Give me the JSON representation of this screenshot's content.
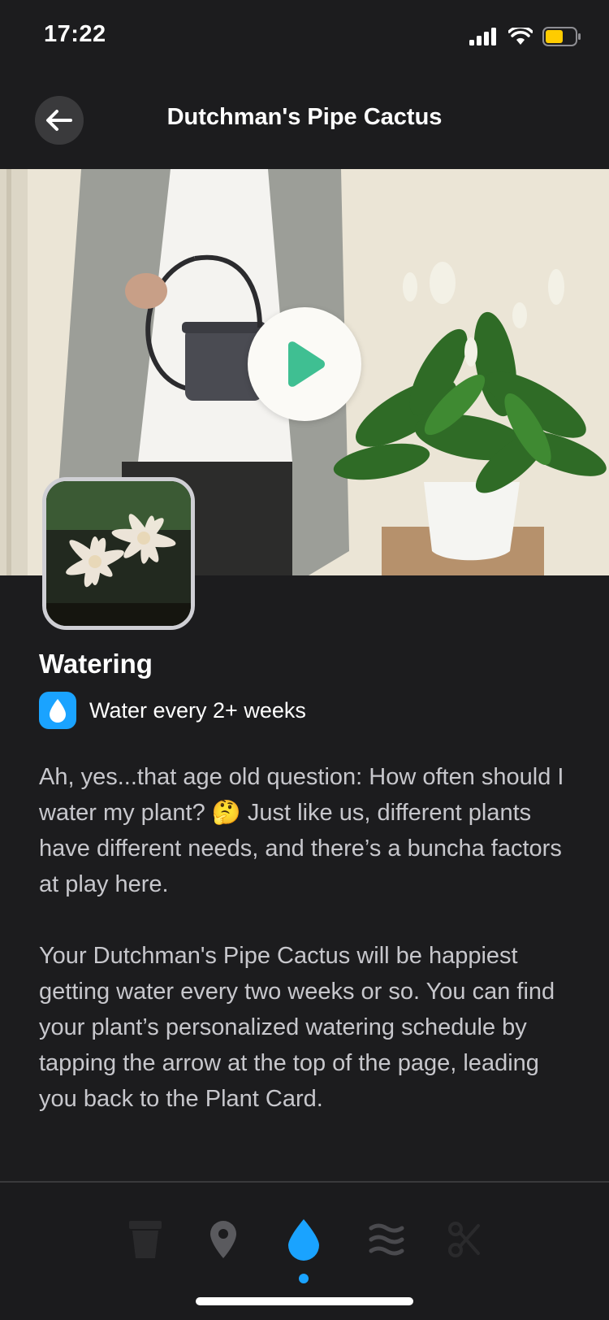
{
  "status_bar": {
    "time": "17:22"
  },
  "header": {
    "title": "Dutchman's Pipe Cactus"
  },
  "hero": {
    "play_label": "Play video"
  },
  "section": {
    "title": "Watering",
    "frequency": "Water every 2+ weeks",
    "paragraphs": [
      "Ah, yes...that age old question: How often should I water my plant? 🤔 Just like us, different plants have different needs, and there’s a buncha factors at play here.",
      "Your Dutchman's Pipe Cactus will be happiest getting water every two weeks or so. You can find your plant’s personalized watering schedule by tapping the arrow at the top of the page, leading you back to the Plant Card."
    ]
  },
  "bottom_nav": {
    "items": [
      {
        "icon": "pot-icon",
        "active": false
      },
      {
        "icon": "location-pin-icon",
        "active": false
      },
      {
        "icon": "water-drop-icon",
        "active": true
      },
      {
        "icon": "humidity-waves-icon",
        "active": false
      },
      {
        "icon": "scissors-icon",
        "active": false
      }
    ]
  },
  "colors": {
    "background": "#1c1c1e",
    "accent": "#1aa3ff",
    "play_triangle": "#3fbf92",
    "battery": "#ffcc00"
  }
}
